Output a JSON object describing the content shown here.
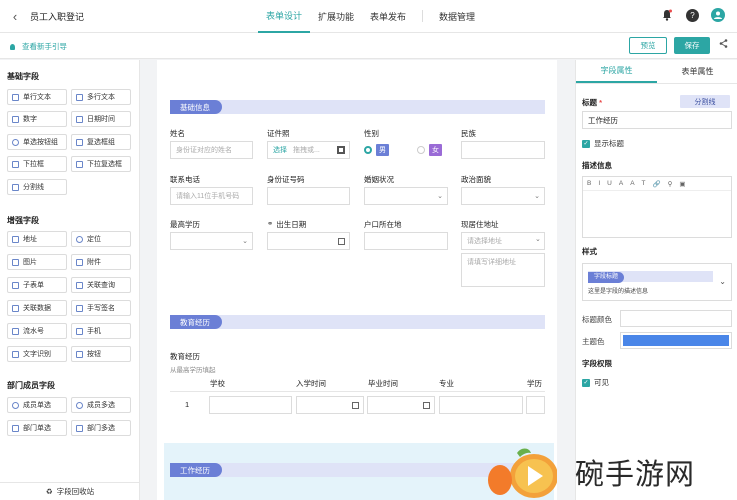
{
  "app": {
    "title": "员工入职登记"
  },
  "top_tabs": [
    {
      "label": "表单设计"
    },
    {
      "label": "扩展功能"
    },
    {
      "label": "表单发布"
    },
    {
      "label": "数据管理"
    }
  ],
  "toolbar": {
    "guide": "查看新手引导",
    "preview": "预览",
    "save": "保存"
  },
  "left": {
    "basic_title": "基础字段",
    "basic": [
      "单行文本",
      "多行文本",
      "数字",
      "日期时间",
      "单选按钮组",
      "复选框组",
      "下拉框",
      "下拉复选框",
      "分割线"
    ],
    "enhanced_title": "增强字段",
    "enhanced": [
      "地址",
      "定位",
      "图片",
      "附件",
      "子表单",
      "关联查询",
      "关联数据",
      "手写签名",
      "流水号",
      "手机",
      "文字识别",
      "按钮"
    ],
    "dept_title": "部门成员字段",
    "dept": [
      "成员单选",
      "成员多选",
      "部门单选",
      "部门多选"
    ],
    "recycle": "字段回收站"
  },
  "form": {
    "section1": "基础信息",
    "name_label": "姓名",
    "name_ph": "身份证对应的姓名",
    "id_photo_label": "证件照",
    "id_photo_select": "选择",
    "id_photo_ph": "拖拽或...",
    "gender_label": "性别",
    "gender_male": "男",
    "gender_female": "女",
    "ethnic_label": "民族",
    "phone_label": "联系电话",
    "phone_ph": "请输入11位手机号码",
    "idno_label": "身份证号码",
    "marital_label": "婚姻状况",
    "political_label": "政治面貌",
    "edu_label": "最高学历",
    "birth_label": "出生日期",
    "hukou_label": "户口所在地",
    "address_label": "现居住地址",
    "address_ph": "请选择地址",
    "address_detail_ph": "请填写详细地址",
    "section2": "教育经历",
    "edu_hist_label": "教育经历",
    "edu_hist_desc": "从最高学历填起",
    "cols": [
      "学校",
      "入学时间",
      "毕业时间",
      "专业",
      "学历"
    ],
    "row_no": "1",
    "section3": "工作经历"
  },
  "right": {
    "tab_field": "字段属性",
    "tab_form": "表单属性",
    "title_label": "标题",
    "required_mark": "*",
    "divider_btn": "分割线",
    "title_value": "工作经历",
    "show_title": "显示标题",
    "desc_label": "描述信息",
    "rte_tools": [
      "B",
      "I",
      "U",
      "A",
      "A",
      "T",
      "🔗",
      "⚲",
      "▣"
    ],
    "style_label": "样式",
    "style_tag": "字段标题",
    "style_desc": "这里是字段的描述信息",
    "title_color_label": "标题颜色",
    "theme_color_label": "主题色",
    "perm_label": "字段权限",
    "visible": "可见"
  },
  "watermark": {
    "text": "碗手游网"
  },
  "colors": {
    "accent": "#2ca6a4",
    "section": "#6b7fd6",
    "theme": "#4a86e8"
  }
}
